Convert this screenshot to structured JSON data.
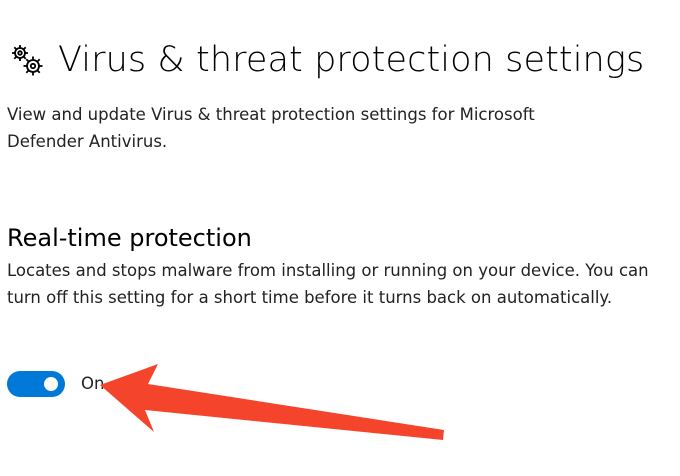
{
  "header": {
    "icon": "gears-icon",
    "title": "Virus & threat protection settings"
  },
  "description": "View and update Virus & threat protection settings for Microsoft Defender Antivirus.",
  "real_time_protection": {
    "title": "Real-time protection",
    "description": "Locates and stops malware from installing or running on your device. You can turn off this setting for a short time before it turns back on automatically.",
    "toggle": {
      "state": "on",
      "label": "On"
    }
  },
  "annotation": {
    "icon": "arrow-icon",
    "color": "#f4452c"
  },
  "colors": {
    "accent": "#0078d7",
    "text": "#000000"
  }
}
